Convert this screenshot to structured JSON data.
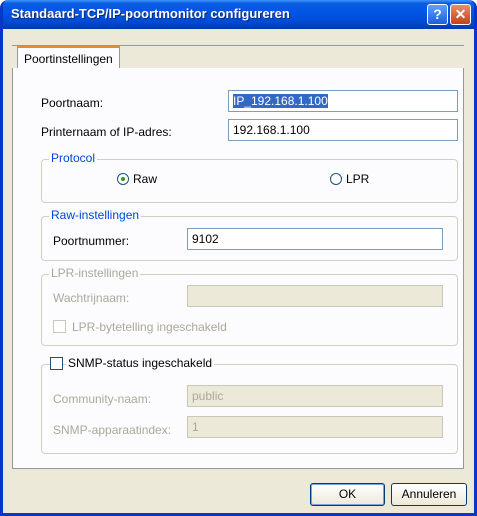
{
  "window": {
    "title": "Standaard-TCP/IP-poortmonitor configureren",
    "help_glyph": "?",
    "close_glyph": "✕"
  },
  "tabs": [
    {
      "label": "Poortinstellingen"
    }
  ],
  "fields": {
    "port_name": {
      "label": "Poortnaam:",
      "value": "IP_192.168.1.100"
    },
    "printer_name": {
      "label": "Printernaam of IP-adres:",
      "value": "192.168.1.100"
    }
  },
  "protocol": {
    "title": "Protocol",
    "raw_label": "Raw",
    "lpr_label": "LPR",
    "selected": "Raw"
  },
  "raw": {
    "title": "Raw-instellingen",
    "port_number_label": "Poortnummer:",
    "port_number": "9102"
  },
  "lpr": {
    "title": "LPR-instellingen",
    "queue_label": "Wachtrijnaam:",
    "queue_value": "",
    "bytecount_label": "LPR-bytetelling ingeschakeld"
  },
  "snmp": {
    "enable_label": "SNMP-status ingeschakeld",
    "community_label": "Community-naam:",
    "community_value": "public",
    "device_index_label": "SNMP-apparaatindex:",
    "device_index_value": "1"
  },
  "buttons": {
    "ok": "OK",
    "cancel": "Annuleren"
  },
  "colors": {
    "title_bar": "#0055e5",
    "group_title": "#0046d5",
    "face": "#ece9d8",
    "selection": "#316ac5"
  }
}
